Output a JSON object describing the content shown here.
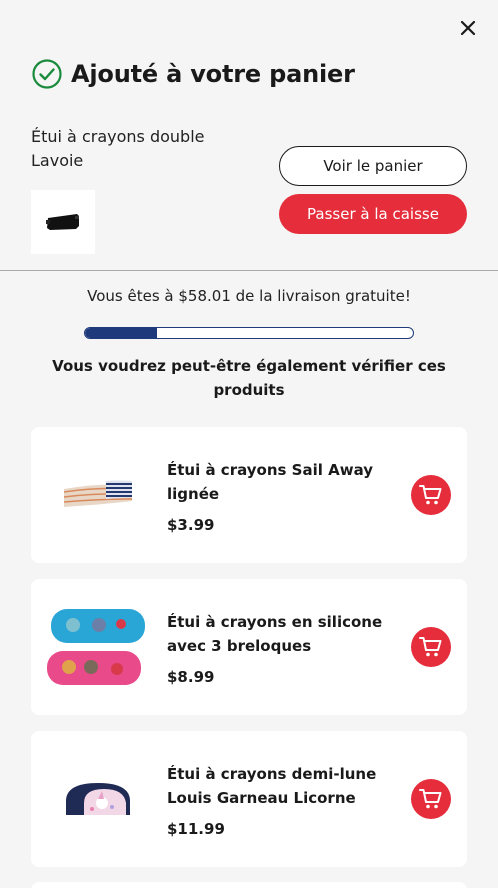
{
  "colors": {
    "accent": "#e52d3b",
    "progress": "#1e3a7a",
    "success": "#1a8a3c"
  },
  "header": {
    "title": "Ajouté à votre panier",
    "close_icon": "close-icon",
    "check_icon": "check-circle-icon"
  },
  "added_item": {
    "name": "Étui à crayons double Lavoie"
  },
  "buttons": {
    "view_cart": "Voir le panier",
    "checkout": "Passer à la caisse"
  },
  "shipping": {
    "message": "Vous êtes à $58.01 de la livraison gratuite!",
    "progress_fraction": 0.22
  },
  "recommendations": {
    "title": "Vous voudrez peut-être également vérifier ces produits",
    "items": [
      {
        "name": "Étui à crayons Sail Away lignée",
        "price": "$3.99"
      },
      {
        "name": "Étui à crayons en silicone avec 3 breloques",
        "price": "$8.99"
      },
      {
        "name": "Étui à crayons demi-lune Louis Garneau Licorne",
        "price": "$11.99"
      }
    ],
    "cart_icon": "shopping-cart-icon"
  }
}
